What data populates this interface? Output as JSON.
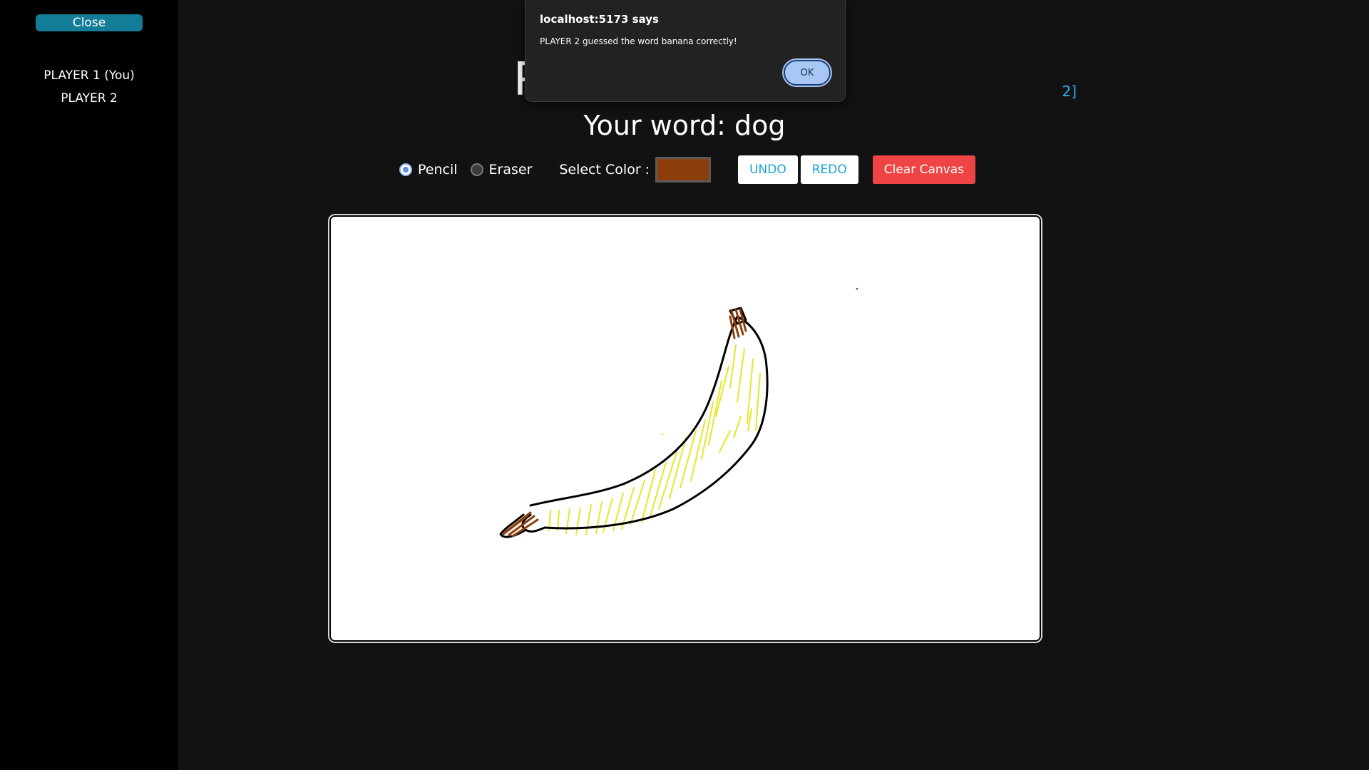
{
  "sidebar": {
    "close_label": "Close",
    "players": [
      "PLAYER 1 (You)",
      "PLAYER 2"
    ]
  },
  "heading": {
    "title_visible_start": "P",
    "round_visible_end": "2]"
  },
  "word": {
    "label": "Your word: ",
    "value": "dog"
  },
  "toolbar": {
    "pencil_label": "Pencil",
    "eraser_label": "Eraser",
    "selected_tool": "Pencil",
    "color_label": "Select Color :",
    "selected_color": "#8b3e0c",
    "undo_label": "UNDO",
    "redo_label": "REDO",
    "clear_label": "Clear Canvas"
  },
  "canvas": {
    "drawing": "banana",
    "stroke_colors": [
      "#000000",
      "#e6e62a",
      "#8b3e0c"
    ]
  },
  "dialog": {
    "title": "localhost:5173 says",
    "message": "PLAYER 2 guessed the word banana correctly!",
    "ok_label": "OK"
  },
  "colors": {
    "accent": "#137c97",
    "link": "#2bb3ee",
    "danger": "#ef4444",
    "background": "#121212",
    "sidebar": "#000000"
  }
}
